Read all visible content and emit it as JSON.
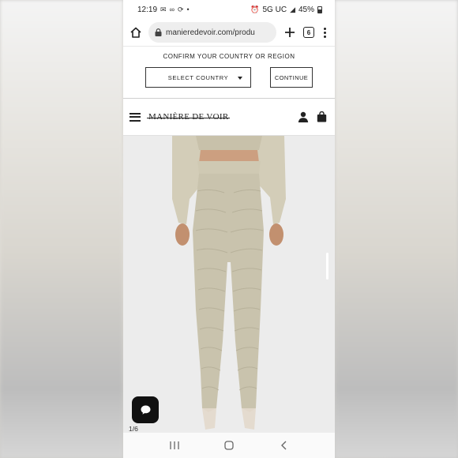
{
  "status_bar": {
    "time": "12:19",
    "network": "5G UC",
    "battery": "45%"
  },
  "browser": {
    "url": "manieredevoir.com/produ",
    "tab_count": "6"
  },
  "country_banner": {
    "title": "CONFIRM YOUR COUNTRY OR REGION",
    "select_label": "SELECT COUNTRY",
    "continue_label": "CONTINUE"
  },
  "site_header": {
    "logo_text": "MANIÈRE DE VOIR"
  },
  "product": {
    "image_counter": "1/6",
    "colors": {
      "garment": "#c9c3ad",
      "background": "#ececec"
    }
  },
  "icons": {
    "home": "home-icon",
    "lock": "lock-icon",
    "new_tab": "plus-icon",
    "menu": "kebab-menu-icon",
    "hamburger": "hamburger-icon",
    "account": "user-icon",
    "bag": "shopping-bag-icon",
    "chat": "chat-icon"
  }
}
